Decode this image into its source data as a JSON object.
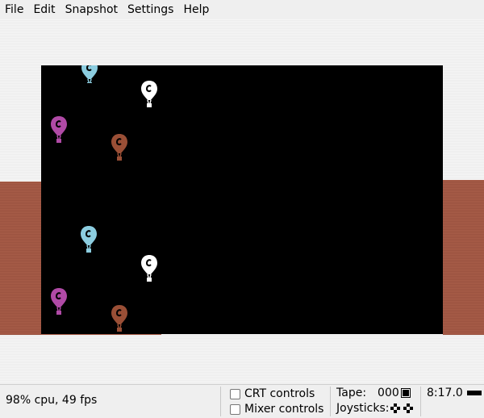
{
  "menu": [
    "File",
    "Edit",
    "Snapshot",
    "Settings",
    "Help"
  ],
  "status": {
    "cpu": "98% cpu, 49 fps",
    "crt_label": "CRT controls",
    "mixer_label": "Mixer controls",
    "tape_label": "Tape:",
    "tape_counter": "000",
    "joysticks_label": "Joysticks:",
    "clock": "8:17.0"
  },
  "colors": {
    "border": "#a85d48",
    "playfield": "#000000",
    "balloon_blue": "#8ccde0",
    "balloon_white": "#ffffff",
    "balloon_magenta": "#b04aa6",
    "balloon_brown": "#9a4f36"
  },
  "balloons": [
    {
      "color": "balloon_blue"
    },
    {
      "color": "balloon_white"
    },
    {
      "color": "balloon_magenta"
    },
    {
      "color": "balloon_brown"
    },
    {
      "color": "balloon_blue"
    },
    {
      "color": "balloon_white"
    },
    {
      "color": "balloon_magenta"
    },
    {
      "color": "balloon_brown"
    }
  ]
}
